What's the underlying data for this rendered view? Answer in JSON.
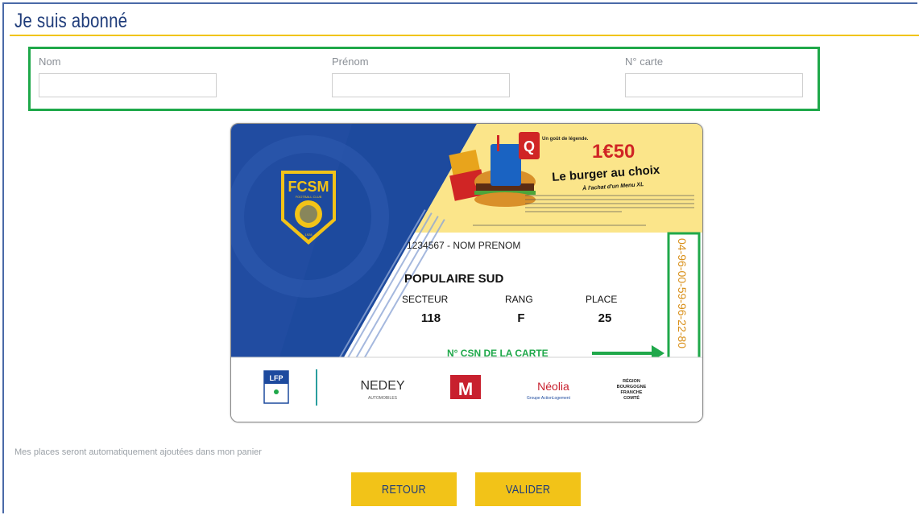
{
  "header": {
    "title": "Je suis abonné"
  },
  "form": {
    "nom": {
      "label": "Nom",
      "value": ""
    },
    "prenom": {
      "label": "Prénom",
      "value": ""
    },
    "carte": {
      "label": "N° carte",
      "value": ""
    }
  },
  "card": {
    "club_logo": "FCSM",
    "club_subtitle": "FOOTBALL CLUB",
    "club_year": "1928",
    "ad": {
      "brand": "Quick",
      "tagline": "Un goût de légende.",
      "price": "1€50",
      "headline": "Le burger au choix",
      "subline": "À l'achat d'un Menu XL"
    },
    "holder": "1234567 - NOM PRENOM",
    "zone": "POPULAIRE SUD",
    "secteur_label": "SECTEUR",
    "secteur": "118",
    "rang_label": "RANG",
    "rang": "F",
    "place_label": "PLACE",
    "place": "25",
    "csn_label": "N° CSN DE LA CARTE",
    "csn": "04-96-00-59-96-22-80",
    "sponsors": [
      "LFP",
      "NEDEY",
      "AUTOMOBILES",
      "M",
      "Néolia",
      "Groupe ActionLogement",
      "RÉGION",
      "BOURGOGNE",
      "FRANCHE",
      "COMTÉ"
    ]
  },
  "note": "Mes places seront automatiquement ajoutées dans mon panier",
  "buttons": {
    "retour": "RETOUR",
    "valider": "VALIDER"
  },
  "colors": {
    "accent": "#f2c318",
    "brand": "#1f3c7a",
    "highlight": "#1fa84a",
    "csn": "#d9901a"
  }
}
